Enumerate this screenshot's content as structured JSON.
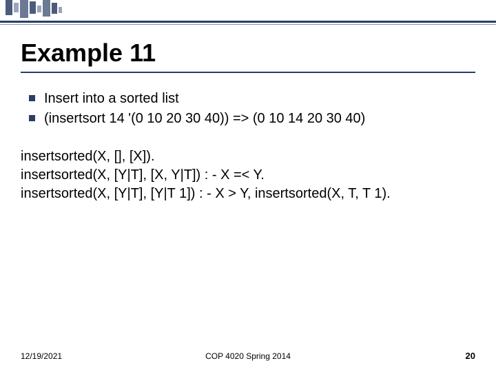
{
  "title": "Example 11",
  "bullets": [
    "Insert into a sorted list",
    "(insertsort 14 '(0 10 20 30 40)) => (0 10 14 20 30 40)"
  ],
  "code": [
    "insertsorted(X, [], [X]).",
    "insertsorted(X, [Y|T], [X, Y|T]) : - X =< Y.",
    "insertsorted(X, [Y|T], [Y|T 1]) : - X > Y, insertsorted(X, T, T 1)."
  ],
  "footer": {
    "date": "12/19/2021",
    "course": "COP 4020 Spring 2014",
    "page": "20"
  }
}
